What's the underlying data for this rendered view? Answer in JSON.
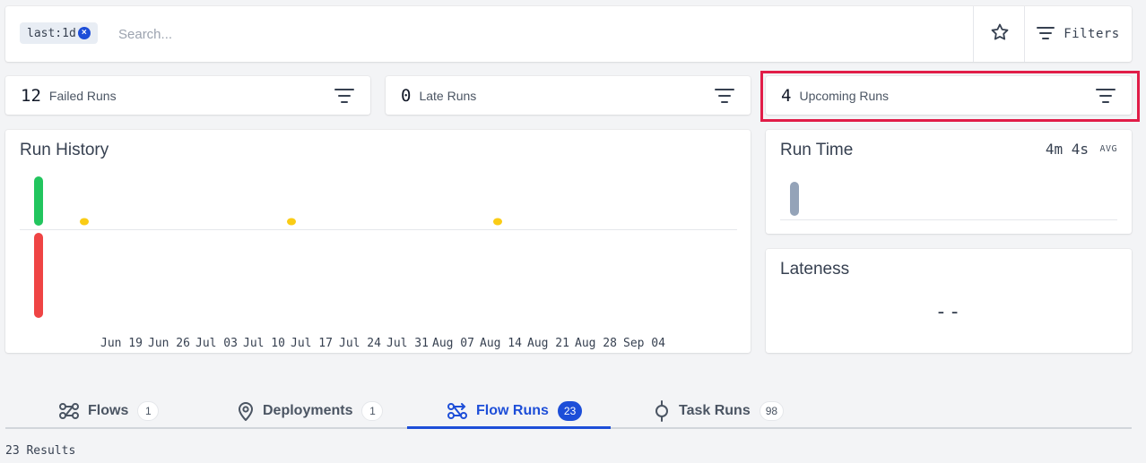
{
  "search": {
    "chip_label": "last:1d",
    "placeholder": "Search...",
    "filters_label": "Filters"
  },
  "stats": {
    "failed": {
      "count": "12",
      "label": "Failed Runs"
    },
    "late": {
      "count": "0",
      "label": "Late Runs"
    },
    "upcoming": {
      "count": "4",
      "label": "Upcoming Runs"
    }
  },
  "run_history": {
    "title": "Run History",
    "x_labels": [
      "Jun 19",
      "Jun 26",
      "Jul 03",
      "Jul 10",
      "Jul 17",
      "Jul 24",
      "Jul 31",
      "Aug 07",
      "Aug 14",
      "Aug 21",
      "Aug 28",
      "Sep 04"
    ]
  },
  "run_time": {
    "title": "Run Time",
    "value": "4m 4s",
    "avg_label": "AVG"
  },
  "lateness": {
    "title": "Lateness",
    "value": "--"
  },
  "tabs": [
    {
      "label": "Flows",
      "count": "1",
      "icon": "flows-icon"
    },
    {
      "label": "Deployments",
      "count": "1",
      "icon": "location-pin-icon"
    },
    {
      "label": "Flow Runs",
      "count": "23",
      "icon": "flow-runs-icon",
      "active": true
    },
    {
      "label": "Task Runs",
      "count": "98",
      "icon": "task-runs-icon"
    }
  ],
  "results": "23 Results",
  "colors": {
    "accent": "#1d4ed8",
    "success": "#22c55e",
    "failed": "#ef4444",
    "scheduled": "#facc15",
    "highlight": "#e11d48"
  }
}
